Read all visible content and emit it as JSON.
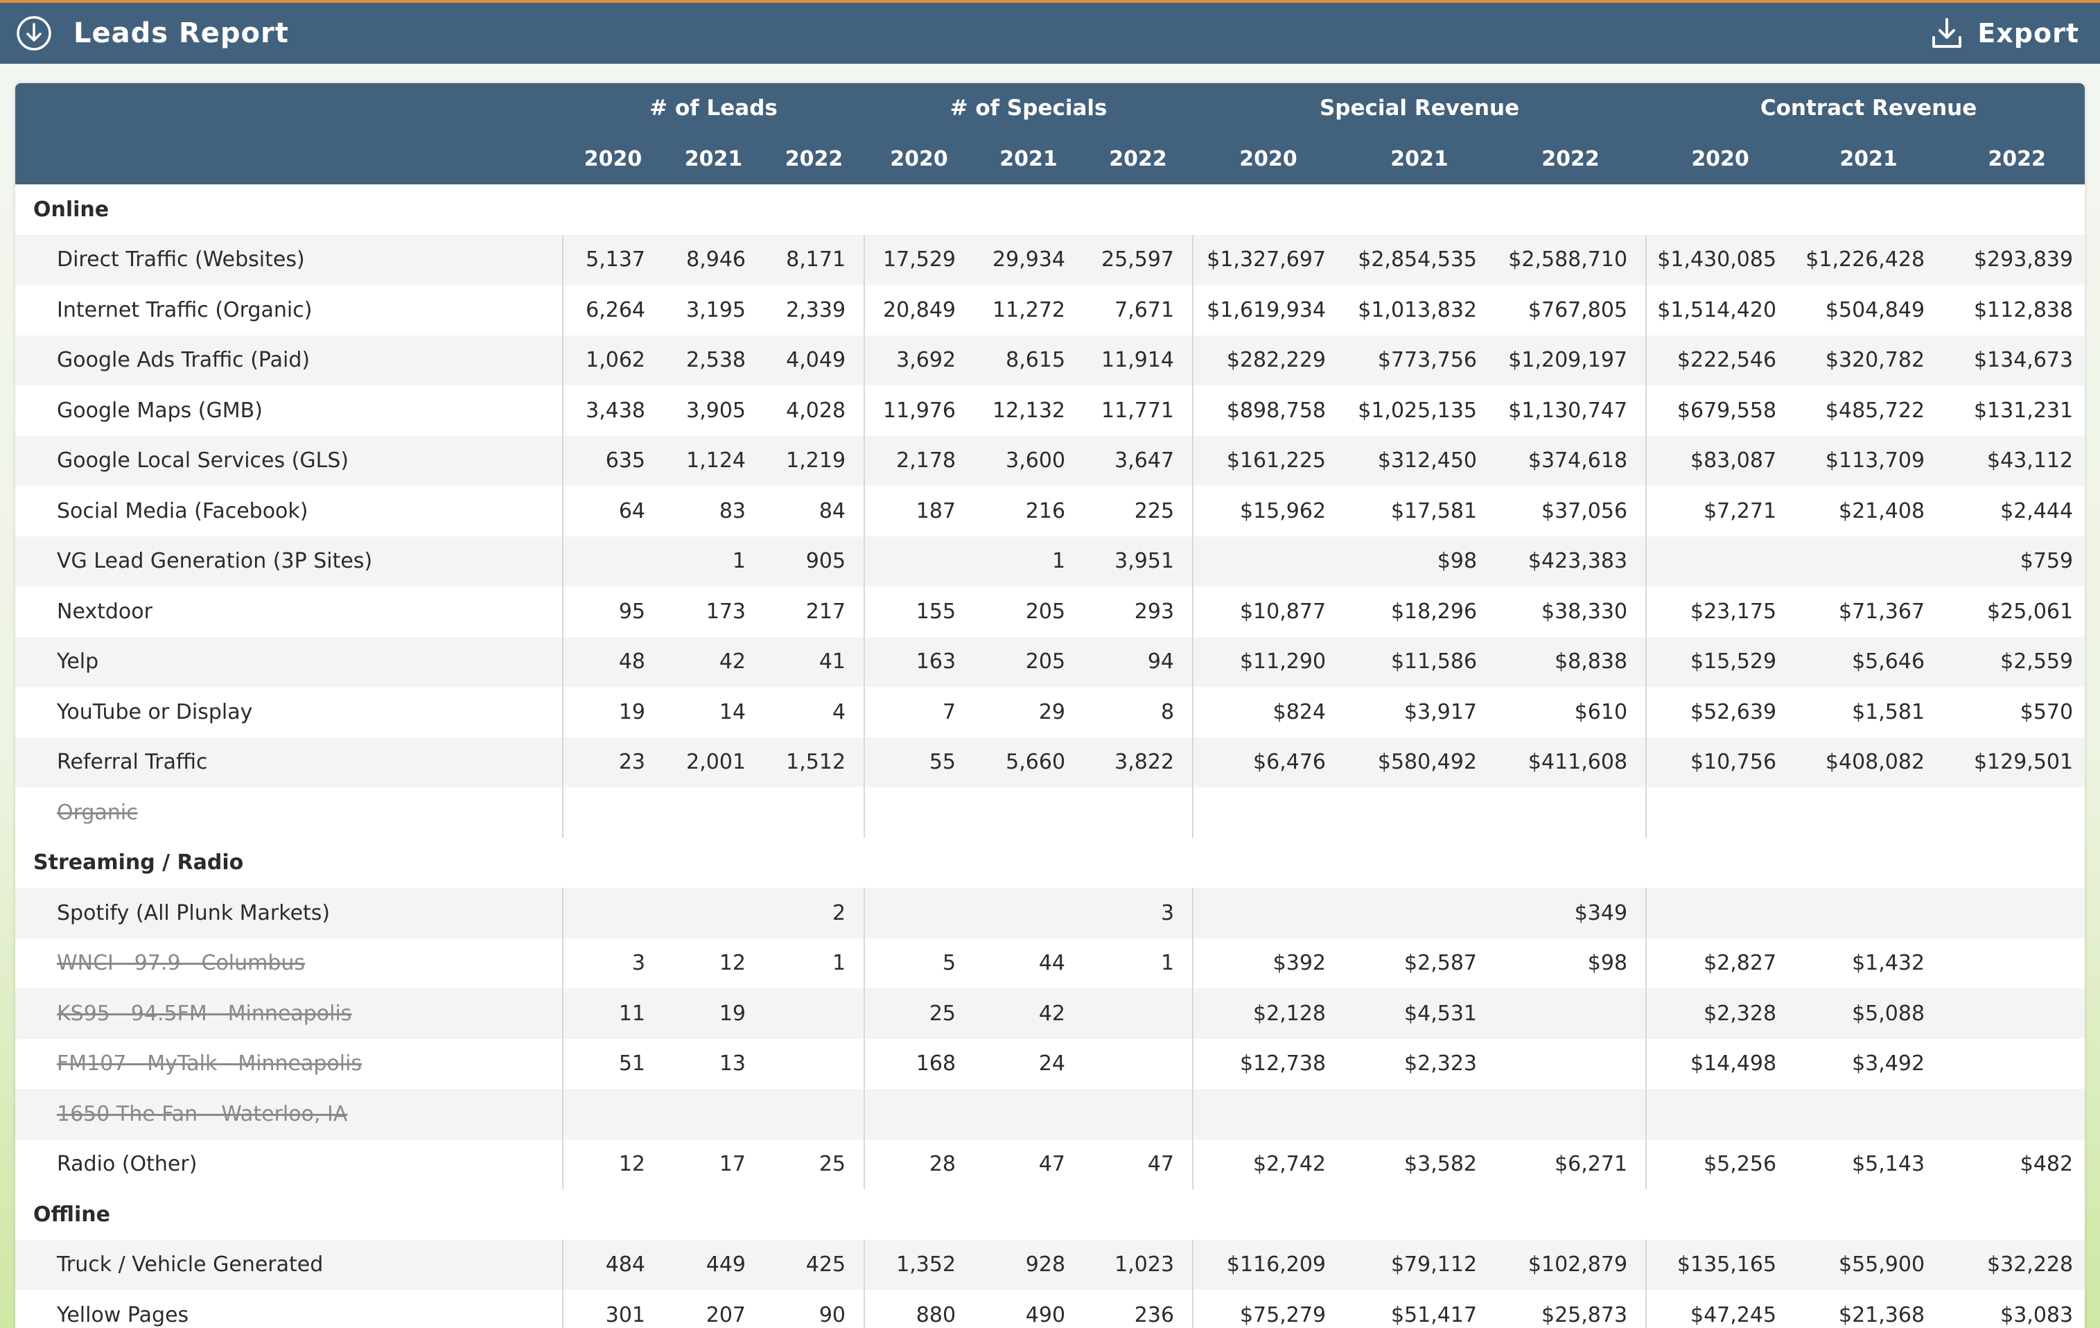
{
  "header": {
    "title": "Leads Report",
    "export_label": "Export"
  },
  "table": {
    "groups": [
      "# of Leads",
      "# of Specials",
      "Special Revenue",
      "Contract Revenue"
    ],
    "years": [
      "2020",
      "2021",
      "2022"
    ],
    "sections": [
      {
        "name": "Online",
        "rows": [
          {
            "name": "Direct Traffic (Websites)",
            "values": [
              "5,137",
              "8,946",
              "8,171",
              "17,529",
              "29,934",
              "25,597",
              "$1,327,697",
              "$2,854,535",
              "$2,588,710",
              "$1,430,085",
              "$1,226,428",
              "$293,839"
            ]
          },
          {
            "name": "Internet Traffic (Organic)",
            "values": [
              "6,264",
              "3,195",
              "2,339",
              "20,849",
              "11,272",
              "7,671",
              "$1,619,934",
              "$1,013,832",
              "$767,805",
              "$1,514,420",
              "$504,849",
              "$112,838"
            ]
          },
          {
            "name": "Google Ads Traffic (Paid)",
            "values": [
              "1,062",
              "2,538",
              "4,049",
              "3,692",
              "8,615",
              "11,914",
              "$282,229",
              "$773,756",
              "$1,209,197",
              "$222,546",
              "$320,782",
              "$134,673"
            ]
          },
          {
            "name": "Google Maps (GMB)",
            "values": [
              "3,438",
              "3,905",
              "4,028",
              "11,976",
              "12,132",
              "11,771",
              "$898,758",
              "$1,025,135",
              "$1,130,747",
              "$679,558",
              "$485,722",
              "$131,231"
            ]
          },
          {
            "name": "Google Local Services (GLS)",
            "values": [
              "635",
              "1,124",
              "1,219",
              "2,178",
              "3,600",
              "3,647",
              "$161,225",
              "$312,450",
              "$374,618",
              "$83,087",
              "$113,709",
              "$43,112"
            ]
          },
          {
            "name": "Social Media (Facebook)",
            "values": [
              "64",
              "83",
              "84",
              "187",
              "216",
              "225",
              "$15,962",
              "$17,581",
              "$37,056",
              "$7,271",
              "$21,408",
              "$2,444"
            ]
          },
          {
            "name": "VG Lead Generation (3P Sites)",
            "values": [
              "",
              "1",
              "905",
              "",
              "1",
              "3,951",
              "",
              "$98",
              "$423,383",
              "",
              "",
              "$759"
            ]
          },
          {
            "name": "Nextdoor",
            "values": [
              "95",
              "173",
              "217",
              "155",
              "205",
              "293",
              "$10,877",
              "$18,296",
              "$38,330",
              "$23,175",
              "$71,367",
              "$25,061"
            ]
          },
          {
            "name": "Yelp",
            "values": [
              "48",
              "42",
              "41",
              "163",
              "205",
              "94",
              "$11,290",
              "$11,586",
              "$8,838",
              "$15,529",
              "$5,646",
              "$2,559"
            ]
          },
          {
            "name": "YouTube or Display",
            "values": [
              "19",
              "14",
              "4",
              "7",
              "29",
              "8",
              "$824",
              "$3,917",
              "$610",
              "$52,639",
              "$1,581",
              "$570"
            ]
          },
          {
            "name": "Referral Traffic",
            "values": [
              "23",
              "2,001",
              "1,512",
              "55",
              "5,660",
              "3,822",
              "$6,476",
              "$580,492",
              "$411,608",
              "$10,756",
              "$408,082",
              "$129,501"
            ]
          },
          {
            "name": "Organic",
            "struck": true,
            "values": [
              "",
              "",
              "",
              "",
              "",
              "",
              "",
              "",
              "",
              "",
              "",
              ""
            ]
          }
        ]
      },
      {
        "name": "Streaming / Radio",
        "rows": [
          {
            "name": "Spotify (All Plunk Markets)",
            "values": [
              "",
              "",
              "2",
              "",
              "",
              "3",
              "",
              "",
              "$349",
              "",
              "",
              ""
            ]
          },
          {
            "name": "WNCI - 97.9 - Columbus",
            "struck": true,
            "values": [
              "3",
              "12",
              "1",
              "5",
              "44",
              "1",
              "$392",
              "$2,587",
              "$98",
              "$2,827",
              "$1,432",
              ""
            ]
          },
          {
            "name": "KS95 - 94.5FM - Minneapolis",
            "struck": true,
            "values": [
              "11",
              "19",
              "",
              "25",
              "42",
              "",
              "$2,128",
              "$4,531",
              "",
              "$2,328",
              "$5,088",
              ""
            ]
          },
          {
            "name": "FM107 - MyTalk - Minneapolis",
            "struck": true,
            "values": [
              "51",
              "13",
              "",
              "168",
              "24",
              "",
              "$12,738",
              "$2,323",
              "",
              "$14,498",
              "$3,492",
              ""
            ]
          },
          {
            "name": "1650 The Fan – Waterloo, IA",
            "struck": true,
            "values": [
              "",
              "",
              "",
              "",
              "",
              "",
              "",
              "",
              "",
              "",
              "",
              ""
            ]
          },
          {
            "name": "Radio (Other)",
            "values": [
              "12",
              "17",
              "25",
              "28",
              "47",
              "47",
              "$2,742",
              "$3,582",
              "$6,271",
              "$5,256",
              "$5,143",
              "$482"
            ]
          }
        ]
      },
      {
        "name": "Offline",
        "rows": [
          {
            "name": "Truck / Vehicle Generated",
            "values": [
              "484",
              "449",
              "425",
              "1,352",
              "928",
              "1,023",
              "$116,209",
              "$79,112",
              "$102,879",
              "$135,165",
              "$55,900",
              "$32,228"
            ]
          },
          {
            "name": "Yellow Pages",
            "values": [
              "301",
              "207",
              "90",
              "880",
              "490",
              "236",
              "$75,279",
              "$51,417",
              "$25,873",
              "$47,245",
              "$21,368",
              "$3,083"
            ]
          }
        ]
      }
    ]
  },
  "colors": {
    "header_bg": "#42617c",
    "accent_line": "#e0913f",
    "row_alt": "#f2f4f2"
  },
  "icons": {
    "header": "download-circle-icon",
    "export": "download-tray-icon"
  }
}
